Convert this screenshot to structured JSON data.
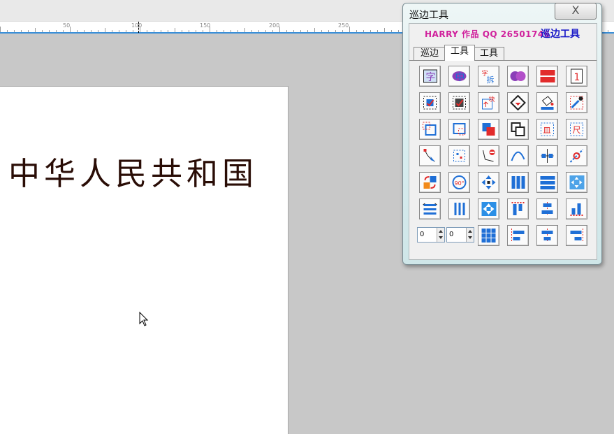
{
  "ruler": {
    "labels": [
      "50",
      "100",
      "150",
      "200",
      "250"
    ]
  },
  "document": {
    "text": "中华人民共和国"
  },
  "tool_window": {
    "title": "巡边工具",
    "close_label": "X",
    "credit": "HARRY 作品 QQ 26501746",
    "brand": "巡边工具",
    "tabs": [
      {
        "label": "巡边",
        "active": false
      },
      {
        "label": "工具",
        "active": true
      },
      {
        "label": "工具",
        "active": false
      }
    ],
    "spin1_value": "0",
    "spin2_value": "0",
    "icons": [
      "character-outline-icon",
      "character-fill-icon",
      "split-text-icon",
      "merge-char-icon",
      "red-bars-icon",
      "page-number-icon",
      "grid-select-icon",
      "grid-fill-icon",
      "block-insert-icon",
      "diamond-cut-icon",
      "bucket-fill-icon",
      "eyedropper-icon",
      "frame-corner-icon",
      "frame-move-icon",
      "bring-front-icon",
      "send-back-icon",
      "ruler-unit-icon",
      "ruler-measure-icon",
      "node-edit-icon",
      "node-dots-icon",
      "node-delete-icon",
      "curve-smooth-icon",
      "node-align-icon",
      "line-break-icon",
      "rotate-swap-icon",
      "rotate-90-icon",
      "move-arrows-icon",
      "columns-icon",
      "rows-icon",
      "center-move-icon",
      "space-horizontal-icon",
      "space-vertical-icon",
      "expand-arrows-icon",
      "align-top-icon",
      "align-center-v-icon",
      "align-bottom-icon",
      "grid-9-icon",
      "align-left-icon",
      "align-center-h-icon",
      "align-right-icon"
    ]
  }
}
